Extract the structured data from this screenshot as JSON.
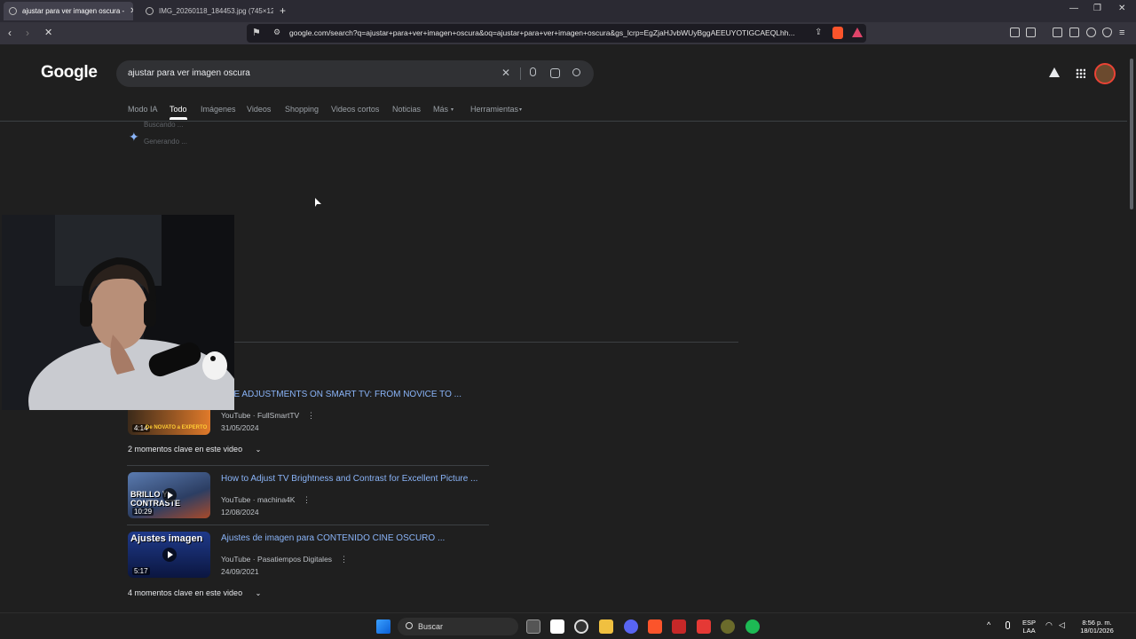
{
  "browser": {
    "tabs": [
      {
        "label": "ajustar para ver imagen oscura -",
        "active": true
      },
      {
        "label": "IMG_20260118_184453.jpg (745×12...",
        "active": false
      }
    ],
    "new_tab": "+",
    "url": "google.com/search?q=ajustar+para+ver+imagen+oscura&oq=ajustar+para+ver+imagen+oscura&gs_lcrp=EgZjaHJvbWUyBggAEEUYOTIGCAEQLhh..."
  },
  "google": {
    "logo": "Google",
    "query": "ajustar para ver imagen oscura",
    "tabs": [
      "Modo IA",
      "Todo",
      "Imágenes",
      "Videos",
      "Shopping",
      "Videos cortos",
      "Noticias",
      "Más",
      "Herramientas"
    ],
    "active_tab": "Todo",
    "ai_status_1": "Buscando ...",
    "ai_status_2": "Generando ...",
    "videos": [
      {
        "title": "AGE ADJUSTMENTS ON SMART TV: FROM NOVICE TO ...",
        "source": "YouTube · FullSmartTV",
        "date": "31/05/2024",
        "duration": "4:14",
        "thumb_text": "De NOVATO a EXPERTO"
      },
      {
        "title": "How to Adjust TV Brightness and Contrast for Excellent Picture ...",
        "source": "YouTube · machina4K",
        "date": "12/08/2024",
        "duration": "10:29",
        "thumb_text": "BRILLO Y CONTRASTE"
      },
      {
        "title": "Ajustes de imagen para CONTENIDO CINE OSCURO ...",
        "source": "YouTube · Pasatiempos Digitales",
        "date": "24/09/2021",
        "duration": "5:17",
        "thumb_text": "Ajustes imagen"
      }
    ],
    "moments_1": "2 momentos clave en este video",
    "moments_2": "4 momentos clave en este video"
  },
  "taskbar": {
    "search_label": "Buscar",
    "lang_1": "ESP",
    "lang_2": "LAA",
    "time": "8:56 p. m.",
    "date": "18/01/2026"
  },
  "colors": {
    "link": "#8ab4f8",
    "page_bg": "#1f1f1f",
    "brave": "#fb542b"
  }
}
